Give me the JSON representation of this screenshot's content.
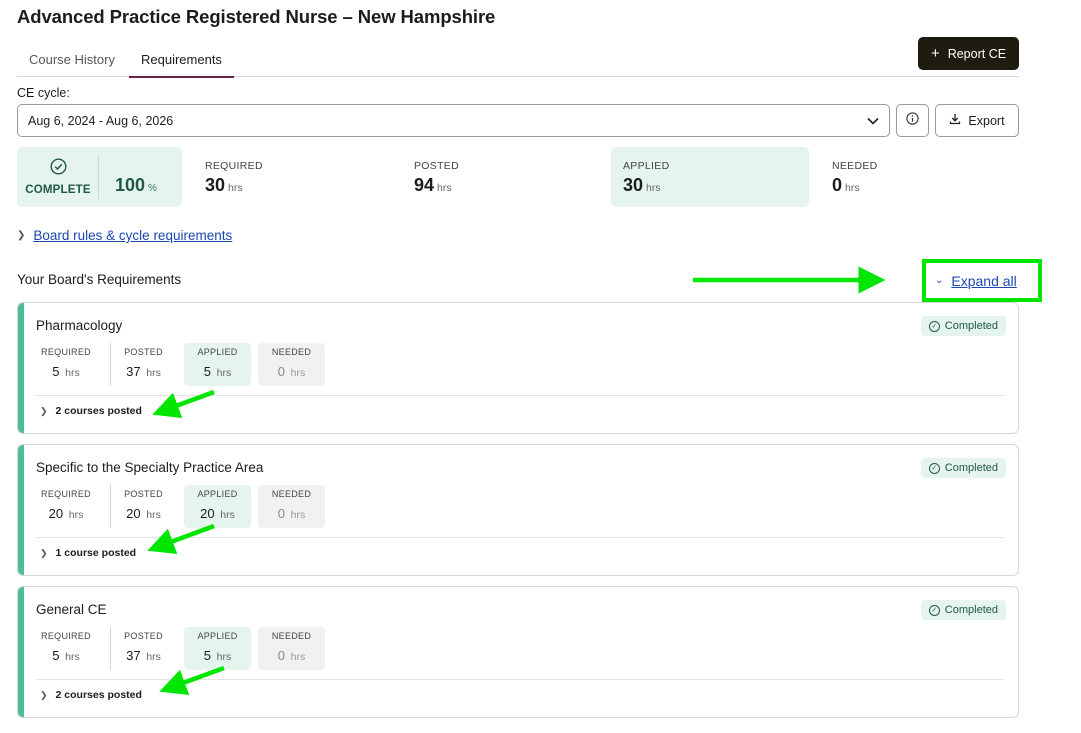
{
  "page": {
    "title": "Advanced Practice Registered Nurse – New Hampshire"
  },
  "tabs": [
    {
      "label": "Course History"
    },
    {
      "label": "Requirements"
    }
  ],
  "report_button": {
    "label": "Report CE",
    "icon": "plus-icon"
  },
  "cycle": {
    "label": "CE cycle:",
    "value": "Aug 6, 2024 - Aug 6, 2026"
  },
  "export_button": {
    "label": "Export",
    "icon": "download-icon"
  },
  "summary": {
    "status": "COMPLETE",
    "percent": "100",
    "percent_unit": "%",
    "unit": "hrs",
    "stats": [
      {
        "label": "REQUIRED",
        "value": "30"
      },
      {
        "label": "POSTED",
        "value": "94"
      },
      {
        "label": "APPLIED",
        "value": "30"
      },
      {
        "label": "NEEDED",
        "value": "0"
      }
    ]
  },
  "board_rules": {
    "label": "Board rules & cycle requirements"
  },
  "requirements": {
    "title": "Your Board's Requirements",
    "expand_all": "Expand all",
    "unit": "hrs",
    "stat_labels": [
      "REQUIRED",
      "POSTED",
      "APPLIED",
      "NEEDED"
    ],
    "cards": [
      {
        "title": "Pharmacology",
        "status": "Completed",
        "required": "5",
        "posted": "37",
        "applied": "5",
        "needed": "0",
        "courses": "2 courses posted"
      },
      {
        "title": "Specific to the Specialty Practice Area",
        "status": "Completed",
        "required": "20",
        "posted": "20",
        "applied": "20",
        "needed": "0",
        "courses": "1 course posted"
      },
      {
        "title": "General CE",
        "status": "Completed",
        "required": "5",
        "posted": "37",
        "applied": "5",
        "needed": "0",
        "courses": "2 courses posted"
      }
    ]
  },
  "colors": {
    "accent": "#4cbe96",
    "annotation": "#00e600",
    "tab_underline": "#6b1f4a",
    "link": "#1b46b3"
  }
}
